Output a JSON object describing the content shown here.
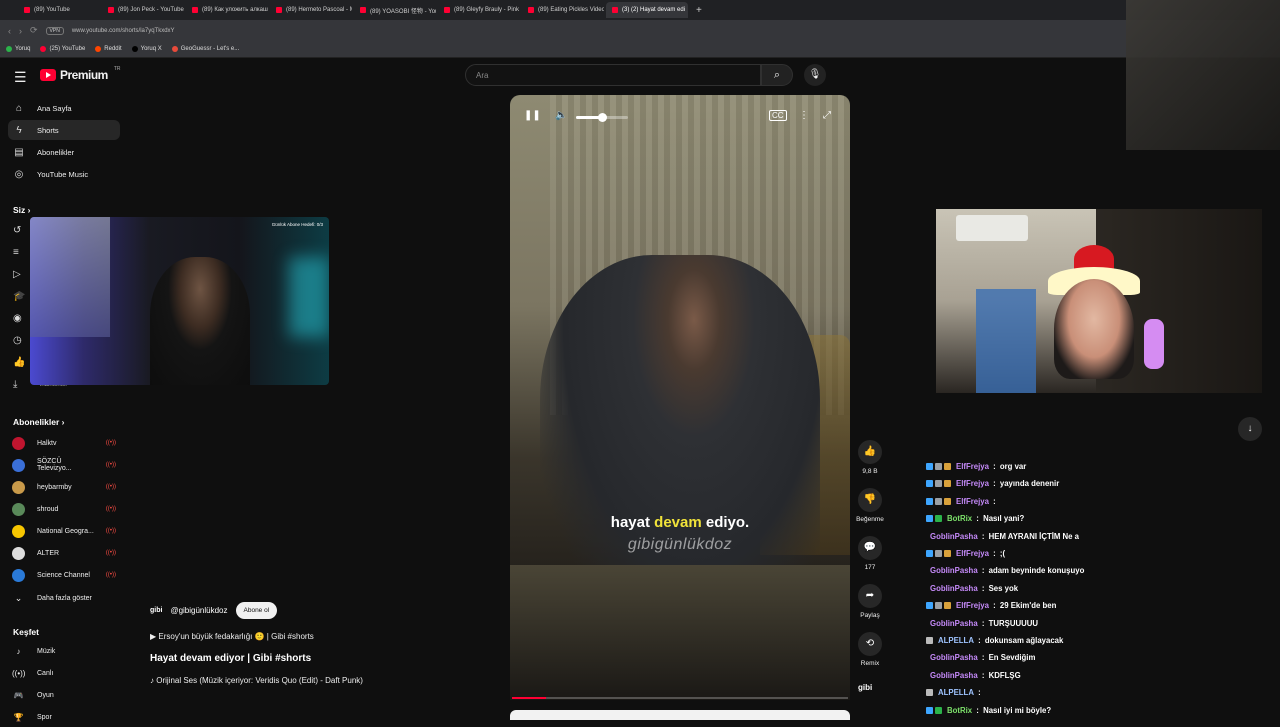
{
  "browser": {
    "tabs": [
      {
        "label": "(89) YouTube"
      },
      {
        "label": "(89) Jon Peck - YouTube"
      },
      {
        "label": "(89) Как уложить алкаш"
      },
      {
        "label": "(89) Hermeto Pascoal - M"
      },
      {
        "label": "(89) YOASOBI 怪物 - You"
      },
      {
        "label": "(89) Gleyfy Brauly - Pink F"
      },
      {
        "label": "(89) Eating Pickles Video"
      },
      {
        "label": "(3) (2) Hayat devam edi"
      }
    ],
    "new_tab": "+",
    "vpn": "VPN",
    "url": "www.youtube.com/shorts/la7yqTkxdxY",
    "bookmarks": [
      "Yoruq",
      "(25) YouTube",
      "Reddit",
      "Yoruq X",
      "GeoGuessr - Let's e..."
    ]
  },
  "header": {
    "logo": "Premium",
    "logo_sup": "TR",
    "search_placeholder": "Ara"
  },
  "sidebar": {
    "main": [
      {
        "label": "Ana Sayfa",
        "icon": "home-icon"
      },
      {
        "label": "Shorts",
        "icon": "shorts-icon"
      },
      {
        "label": "Abonelikler",
        "icon": "subscriptions-icon"
      },
      {
        "label": "YouTube Music",
        "icon": "music-icon"
      }
    ],
    "you_heading": "Siz",
    "you_partial": "indirilenler",
    "subs_heading": "Abonelikler",
    "subs": [
      {
        "label": "Halktv",
        "color": "#c0152f"
      },
      {
        "label": "SÖZCÜ Televizyo...",
        "color": "#3a6fd8"
      },
      {
        "label": "heybarmby",
        "color": "#c99a4a"
      },
      {
        "label": "shroud",
        "color": "#5a8a5a"
      },
      {
        "label": "National Geogra...",
        "color": "#f7c600"
      },
      {
        "label": "ALTER",
        "color": "#dddddd"
      },
      {
        "label": "Science Channel",
        "color": "#2a7ad8"
      }
    ],
    "show_more": "Daha fazla göster",
    "explore_heading": "Keşfet",
    "explore": [
      {
        "label": "Müzik"
      },
      {
        "label": "Canlı"
      },
      {
        "label": "Oyun"
      },
      {
        "label": "Spor"
      }
    ]
  },
  "overlay": {
    "goal": "Günlük Abone Hedefi: 0/3"
  },
  "video": {
    "caption_pre": "hayat ",
    "caption_hl": "devam",
    "caption_post": " ediyo.",
    "watermark": "gibigünlükdoz",
    "volume": 0.5,
    "progress": 0.1
  },
  "actions": {
    "likes": "9,8 B",
    "dislike": "Beğenme",
    "comments": "177",
    "share": "Paylaş",
    "remix": "Remix",
    "channel_mark": "gibi"
  },
  "channel": {
    "logo": "gibi",
    "handle": "@gibigünlükdoz",
    "subscribe": "Abone ol",
    "description": "▶ Ersoy'un büyük fedakarlığı 🙂 | Gibi #shorts",
    "title": "Hayat devam ediyor | Gibi #shorts",
    "music": "♪ Orijinal Ses (Müzik içeriyor: Veridis Quo (Edit) - Daft Punk)"
  },
  "chat": [
    {
      "user": "ElfFrejya",
      "color": "#c58af9",
      "msg": "org var",
      "badges": [
        "#3ea6ff",
        "#9aa0a6",
        "#d9a13b"
      ]
    },
    {
      "user": "ElfFrejya",
      "color": "#c58af9",
      "msg": "yayında denenir",
      "badges": [
        "#3ea6ff",
        "#9aa0a6",
        "#d9a13b"
      ]
    },
    {
      "user": "ElfFrejya",
      "color": "#c58af9",
      "msg": "",
      "badges": [
        "#3ea6ff",
        "#9aa0a6",
        "#d9a13b"
      ]
    },
    {
      "user": "BotRix",
      "color": "#7ce06a",
      "msg": "Nasıl yani?",
      "badges": [
        "#3ea6ff",
        "#2bb34a"
      ]
    },
    {
      "user": "GoblinPasha",
      "color": "#c58af9",
      "msg": "HEM AYRANI İÇTİM Ne a",
      "badges": []
    },
    {
      "user": "ElfFrejya",
      "color": "#c58af9",
      "msg": ";(",
      "badges": [
        "#3ea6ff",
        "#9aa0a6",
        "#d9a13b"
      ]
    },
    {
      "user": "GoblinPasha",
      "color": "#c58af9",
      "msg": "adam beyninde konuşuyo",
      "badges": []
    },
    {
      "user": "GoblinPasha",
      "color": "#c58af9",
      "msg": "Ses yok",
      "badges": []
    },
    {
      "user": "ElfFrejya",
      "color": "#c58af9",
      "msg": "29 Ekim'de ben",
      "badges": [
        "#3ea6ff",
        "#9aa0a6",
        "#d9a13b"
      ]
    },
    {
      "user": "GoblinPasha",
      "color": "#c58af9",
      "msg": "TURŞUUUUU",
      "badges": []
    },
    {
      "user": "ALPELLA",
      "color": "#9fc4ff",
      "msg": "dokunsam ağlayacak",
      "badges": [
        "#bbbbbb"
      ]
    },
    {
      "user": "GoblinPasha",
      "color": "#c58af9",
      "msg": "En Sevdiğim",
      "badges": []
    },
    {
      "user": "GoblinPasha",
      "color": "#c58af9",
      "msg": "KDFLŞG",
      "badges": []
    },
    {
      "user": "ALPELLA",
      "color": "#9fc4ff",
      "msg": "",
      "badges": [
        "#bbbbbb"
      ]
    },
    {
      "user": "BotRix",
      "color": "#7ce06a",
      "msg": "Nasıl iyi mi böyle?",
      "badges": [
        "#3ea6ff",
        "#2bb34a"
      ]
    }
  ]
}
